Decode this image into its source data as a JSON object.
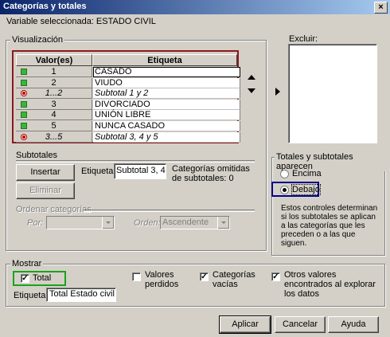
{
  "window": {
    "title": "Categorías y totales",
    "close_label": "×"
  },
  "variable_line": "Variable seleccionada: ESTADO CIVIL",
  "visualizacion": {
    "label": "Visualización",
    "col_value": "Valor(es)",
    "col_label": "Etiqueta",
    "rows": [
      {
        "marker": "green",
        "value": "1",
        "label": "CASADO",
        "subtotal": false
      },
      {
        "marker": "green",
        "value": "2",
        "label": "VIUDO",
        "subtotal": false
      },
      {
        "marker": "red",
        "value": "1...2",
        "label": "Subtotal 1 y 2",
        "subtotal": true
      },
      {
        "marker": "green",
        "value": "3",
        "label": "DIVORCIADO",
        "subtotal": false
      },
      {
        "marker": "green",
        "value": "4",
        "label": "UNIÓN LIBRE",
        "subtotal": false
      },
      {
        "marker": "green",
        "value": "5",
        "label": "NUNCA CASADO",
        "subtotal": false
      },
      {
        "marker": "red",
        "value": "3...5",
        "label": "Subtotal 3, 4 y 5",
        "subtotal": true
      }
    ]
  },
  "excluir": {
    "label": "Excluir:"
  },
  "subtotales": {
    "label": "Subtotales",
    "insertar": "Insertar",
    "eliminar": "Eliminar",
    "etiqueta_label": "Etiqueta:",
    "etiqueta_value": "Subtotal 3, 4 y",
    "omitidas": "Categorías omitidas de subtotales: 0"
  },
  "ordenar": {
    "label": "Ordenar categorías",
    "por_label": "Por:",
    "por_value": "",
    "orden_label": "Orden:",
    "orden_value": "Ascendente"
  },
  "totales": {
    "label": "Totales y subtotales aparecen",
    "encima": "Encima",
    "debajo": "Debajo",
    "description": "Estos controles determinan si los subtotales se aplican a las categorías que les preceden o a las que siguen."
  },
  "mostrar": {
    "label": "Mostrar",
    "total": "Total",
    "valores_perdidos": "Valores perdidos",
    "categorias_vacias": "Categorías vacías",
    "otros_valores": "Otros valores encontrados al explorar los datos",
    "etiqueta_label": "Etiqueta:",
    "etiqueta_value": "Total Estado civil"
  },
  "buttons": {
    "aplicar": "Aplicar",
    "cancelar": "Cancelar",
    "ayuda": "Ayuda"
  },
  "colors": {
    "title_gradient_start": "#0a246a",
    "grid_frame": "#8b1a1a",
    "debajo_highlight": "#00008b",
    "total_highlight": "#1aa31a",
    "marker_green": "#3cb43c",
    "marker_red": "#c00000"
  }
}
